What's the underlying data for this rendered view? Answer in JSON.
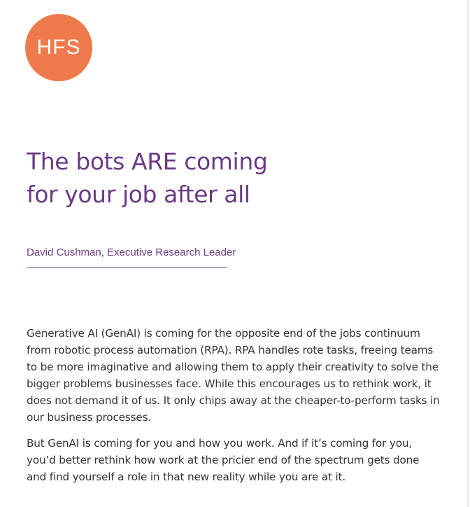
{
  "logo": {
    "text": "HFS",
    "color": "#ee7a4c"
  },
  "title": {
    "line1": "The bots ARE coming",
    "line2": "for your job after all",
    "color": "#6b3a84"
  },
  "byline": {
    "text": "David Cushman, Executive Research Leader",
    "color": "#6b3a84"
  },
  "body": {
    "paragraph1": [
      "Generative AI (GenAI) is coming for the opposite end of the jobs continuum",
      "from robotic process automation (RPA). RPA handles rote tasks, freeing teams",
      "to be more imaginative and allowing them to apply their creativity to solve the",
      "bigger problems businesses face. While this encourages us to rethink work, it",
      "does not demand it of us. It only chips away at the cheaper-to-perform tasks in",
      "our business processes."
    ],
    "paragraph2": [
      "But GenAI is coming for you and how you work. And if it’s coming for you,",
      "you’d better rethink how work at the pricier end of the spectrum gets done",
      "and find yourself a role in that new reality while you are at it."
    ]
  }
}
